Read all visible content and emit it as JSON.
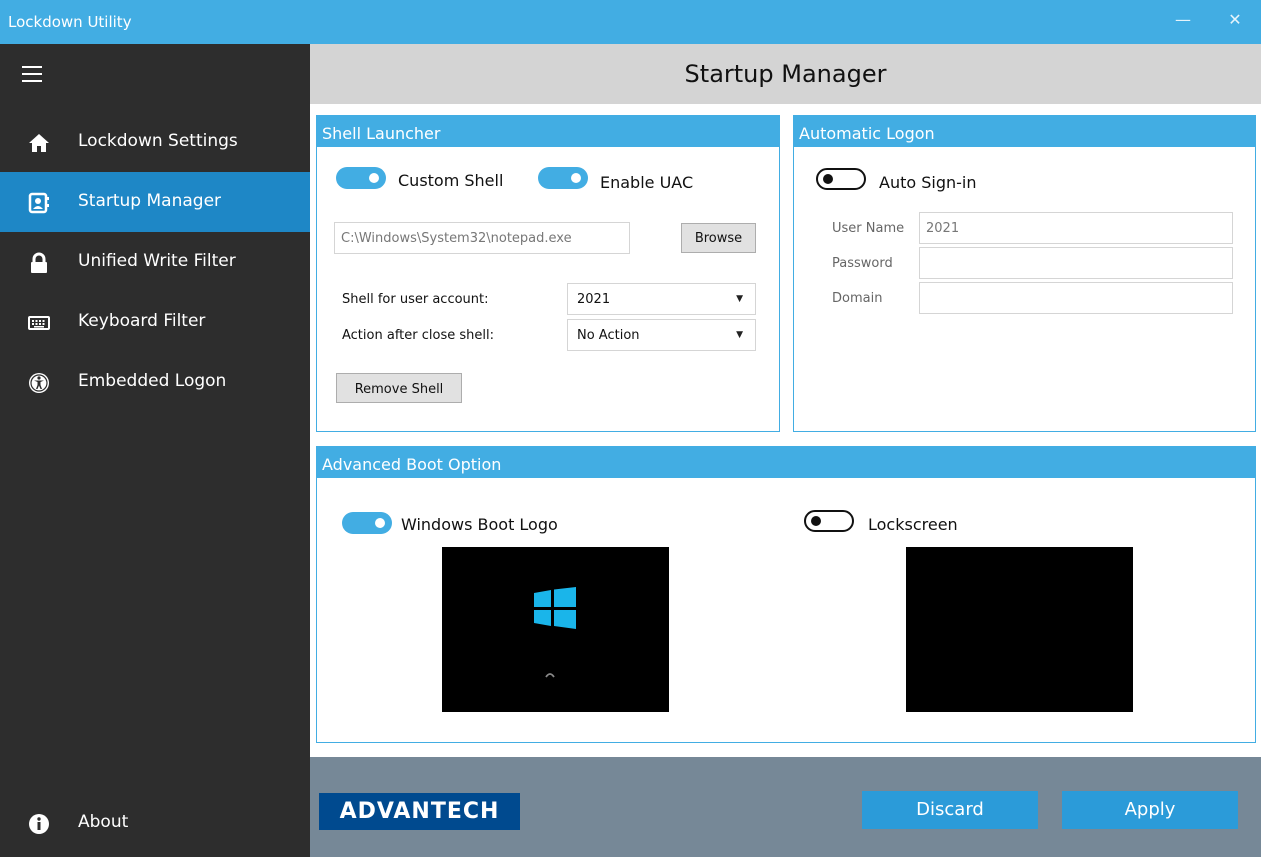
{
  "window": {
    "title": "Lockdown Utility",
    "minimize_glyph": "—",
    "close_glyph": "✕"
  },
  "sidebar": {
    "items": [
      {
        "label": "Lockdown Settings",
        "icon": "home-icon",
        "active": false
      },
      {
        "label": "Startup Manager",
        "icon": "contact-card-icon",
        "active": true
      },
      {
        "label": "Unified Write Filter",
        "icon": "lock-icon",
        "active": false
      },
      {
        "label": "Keyboard Filter",
        "icon": "keyboard-icon",
        "active": false
      },
      {
        "label": "Embedded Logon",
        "icon": "accessibility-icon",
        "active": false
      }
    ],
    "about": {
      "label": "About",
      "icon": "info-icon"
    }
  },
  "header": {
    "title": "Startup Manager"
  },
  "shell_launcher": {
    "title": "Shell Launcher",
    "custom_shell_label": "Custom Shell",
    "custom_shell_on": true,
    "enable_uac_label": "Enable UAC",
    "enable_uac_on": true,
    "shell_path": "C:\\Windows\\System32\\notepad.exe",
    "browse_label": "Browse",
    "shell_for_user_label": "Shell for user account:",
    "shell_for_user_value": "2021",
    "action_after_close_label": "Action after close shell:",
    "action_after_close_value": "No Action",
    "remove_shell_label": "Remove Shell"
  },
  "automatic_logon": {
    "title": "Automatic Logon",
    "auto_signin_label": "Auto Sign-in",
    "auto_signin_on": false,
    "username_label": "User Name",
    "username_value": "2021",
    "password_label": "Password",
    "password_value": "",
    "domain_label": "Domain",
    "domain_value": ""
  },
  "advanced_boot": {
    "title": "Advanced Boot Option",
    "boot_logo_label": "Windows Boot Logo",
    "boot_logo_on": true,
    "lockscreen_label": "Lockscreen",
    "lockscreen_on": false
  },
  "footer": {
    "logo_text": "ADVANTECH",
    "discard_label": "Discard",
    "apply_label": "Apply"
  },
  "colors": {
    "accent": "#42ade3",
    "active_nav": "#1e87c6",
    "sidebar_bg": "#2d2d2d",
    "footer_bg": "#768897",
    "logo_bg": "#004a8f",
    "windows_logo": "#1ab5ea"
  }
}
